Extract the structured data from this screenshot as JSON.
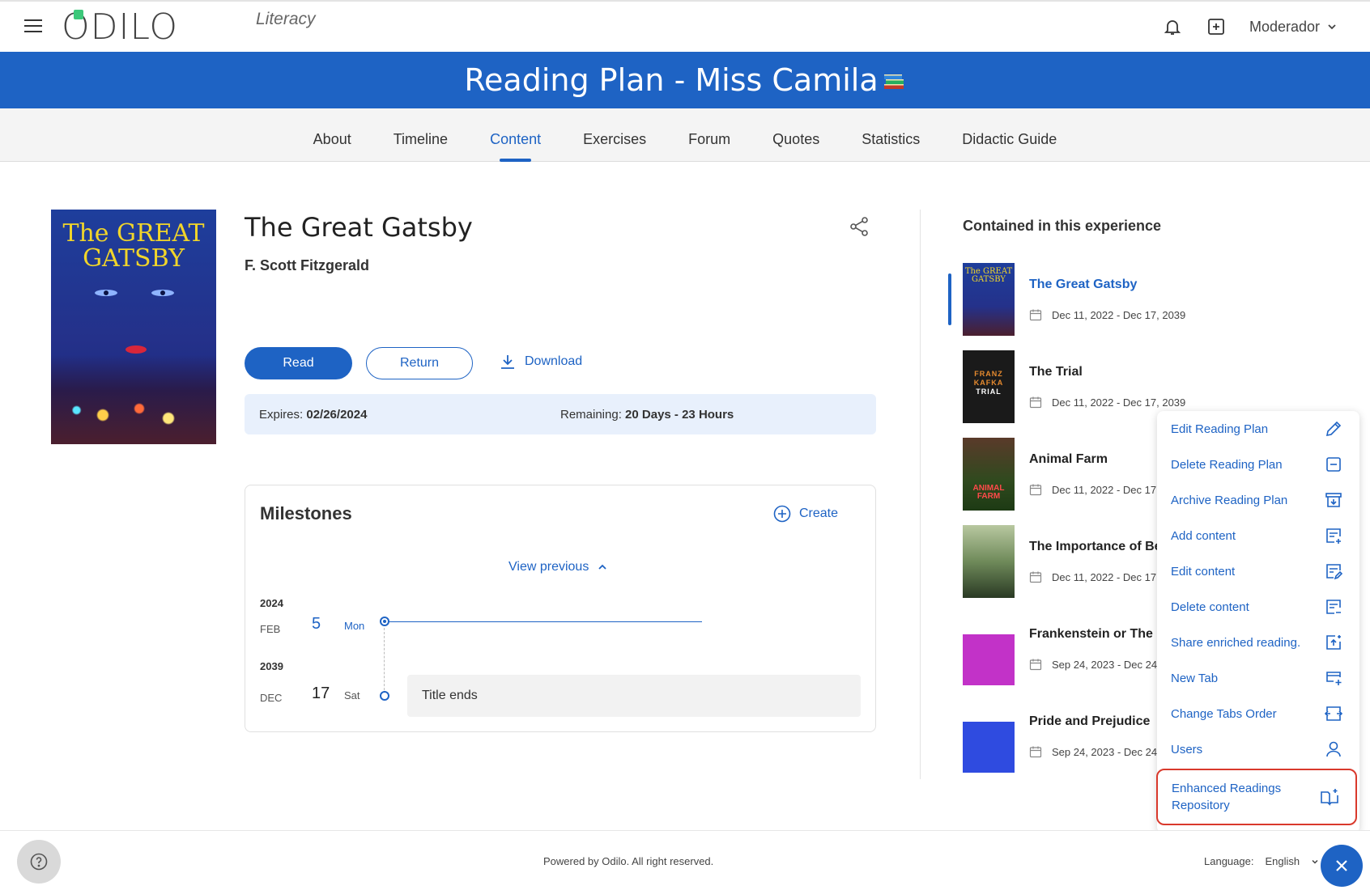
{
  "header": {
    "logo_text": "ODILO",
    "logo_sub": "Literacy",
    "user": "Moderador"
  },
  "banner": {
    "title": "Reading Plan - Miss Camila"
  },
  "tabs": [
    {
      "label": "About"
    },
    {
      "label": "Timeline"
    },
    {
      "label": "Content"
    },
    {
      "label": "Exercises"
    },
    {
      "label": "Forum"
    },
    {
      "label": "Quotes"
    },
    {
      "label": "Statistics"
    },
    {
      "label": "Didactic Guide"
    }
  ],
  "book": {
    "title": "The Great Gatsby",
    "author": "F. Scott Fitzgerald",
    "cover_title": "The GREAT GATSBY",
    "read_label": "Read",
    "return_label": "Return",
    "download_label": "Download",
    "expires_label": "Expires:",
    "expires_value": "02/26/2024",
    "remaining_label": "Remaining:",
    "remaining_value": "20 Days - 23 Hours"
  },
  "milestones": {
    "title": "Milestones",
    "create_label": "Create",
    "view_previous": "View previous",
    "entries": [
      {
        "year": "2024",
        "month": "FEB",
        "day": "5",
        "dow": "Mon"
      },
      {
        "year": "2039",
        "month": "DEC",
        "day": "17",
        "dow": "Sat",
        "event": "Title ends"
      }
    ]
  },
  "contained": {
    "title": "Contained in this experience",
    "items": [
      {
        "title": "The Great Gatsby",
        "dates": "Dec 11, 2022 - Dec 17, 2039"
      },
      {
        "title": "The Trial",
        "dates": "Dec 11, 2022 - Dec 17, 2039"
      },
      {
        "title": "Animal Farm",
        "dates": "Dec 11, 2022 - Dec 17"
      },
      {
        "title": "The Importance of Be",
        "dates": "Dec 11, 2022 - Dec 17"
      },
      {
        "title": "Frankenstein or The r",
        "dates": "Sep 24, 2023 - Dec 24"
      },
      {
        "title": "Pride and Prejudice",
        "dates": "Sep 24, 2023 - Dec 24"
      }
    ]
  },
  "menu": {
    "items": [
      {
        "label": "Edit Reading Plan",
        "icon": "pencil-icon"
      },
      {
        "label": "Delete Reading Plan",
        "icon": "minus-box-icon"
      },
      {
        "label": "Archive Reading Plan",
        "icon": "archive-icon"
      },
      {
        "label": "Add content",
        "icon": "add-content-icon"
      },
      {
        "label": "Edit content",
        "icon": "edit-content-icon"
      },
      {
        "label": "Delete content",
        "icon": "delete-content-icon"
      },
      {
        "label": "Share enriched reading.",
        "icon": "share-enriched-icon"
      },
      {
        "label": "New Tab",
        "icon": "new-tab-icon"
      },
      {
        "label": "Change Tabs Order",
        "icon": "reorder-tabs-icon"
      },
      {
        "label": "Users",
        "icon": "user-icon"
      }
    ],
    "highlighted": {
      "label_line1": "Enhanced Readings",
      "label_line2": "Repository",
      "icon": "book-sparkle-icon"
    }
  },
  "footer": {
    "powered": "Powered by Odilo. All right reserved.",
    "language_label": "Language:",
    "language_value": "English"
  },
  "colors": {
    "brand_blue": "#1e63c4",
    "highlight_red": "#d9392c"
  }
}
